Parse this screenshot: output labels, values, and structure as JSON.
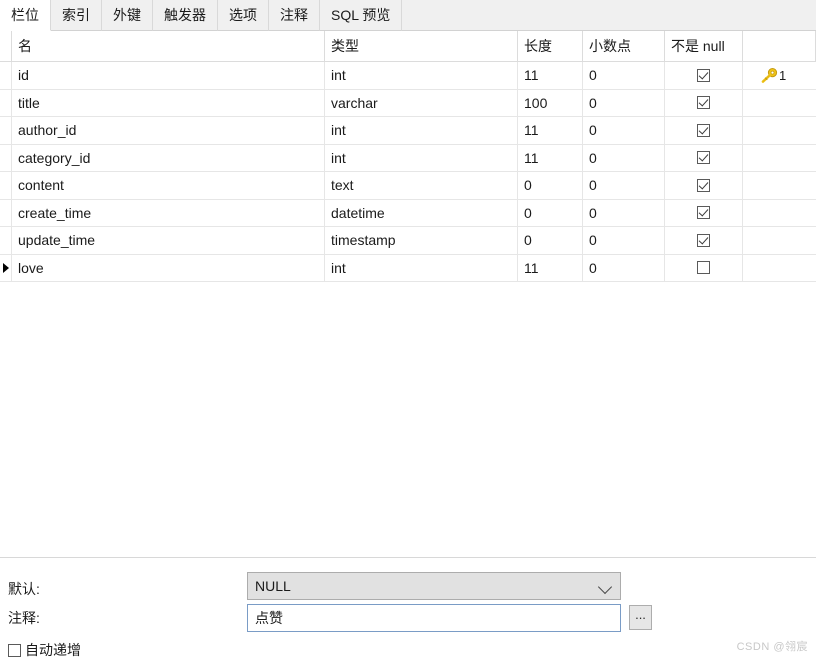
{
  "tabs": [
    {
      "label": "栏位",
      "active": true
    },
    {
      "label": "索引",
      "active": false
    },
    {
      "label": "外键",
      "active": false
    },
    {
      "label": "触发器",
      "active": false
    },
    {
      "label": "选项",
      "active": false
    },
    {
      "label": "注释",
      "active": false
    },
    {
      "label": "SQL 预览",
      "active": false
    }
  ],
  "grid": {
    "columns": [
      "名",
      "类型",
      "长度",
      "小数点",
      "不是 null",
      ""
    ],
    "rows": [
      {
        "selected": false,
        "name": "id",
        "type": "int",
        "length": "11",
        "decimals": "0",
        "not_null": true,
        "key": "1"
      },
      {
        "selected": false,
        "name": "title",
        "type": "varchar",
        "length": "100",
        "decimals": "0",
        "not_null": true,
        "key": ""
      },
      {
        "selected": false,
        "name": "author_id",
        "type": "int",
        "length": "11",
        "decimals": "0",
        "not_null": true,
        "key": ""
      },
      {
        "selected": false,
        "name": "category_id",
        "type": "int",
        "length": "11",
        "decimals": "0",
        "not_null": true,
        "key": ""
      },
      {
        "selected": false,
        "name": "content",
        "type": "text",
        "length": "0",
        "decimals": "0",
        "not_null": true,
        "key": ""
      },
      {
        "selected": false,
        "name": "create_time",
        "type": "datetime",
        "length": "0",
        "decimals": "0",
        "not_null": true,
        "key": ""
      },
      {
        "selected": false,
        "name": "update_time",
        "type": "timestamp",
        "length": "0",
        "decimals": "0",
        "not_null": true,
        "key": ""
      },
      {
        "selected": true,
        "name": "love",
        "type": "int",
        "length": "11",
        "decimals": "0",
        "not_null": false,
        "key": ""
      }
    ]
  },
  "properties": {
    "default_label": "默认:",
    "default_value": "NULL",
    "comment_label": "注释:",
    "comment_value": "点赞",
    "browse_button_label": "...",
    "auto_increment_label": "自动递增",
    "auto_increment_checked": false
  },
  "watermark": "CSDN @翎宸",
  "colors": {
    "key_icon": "#f0c419",
    "tab_active_bg": "#ffffff",
    "tab_inactive_bg": "#f0f0f0",
    "combo_bg": "#e1e1e1",
    "textbox_border": "#7a9cc6",
    "grid_line": "#e6e6e6"
  }
}
